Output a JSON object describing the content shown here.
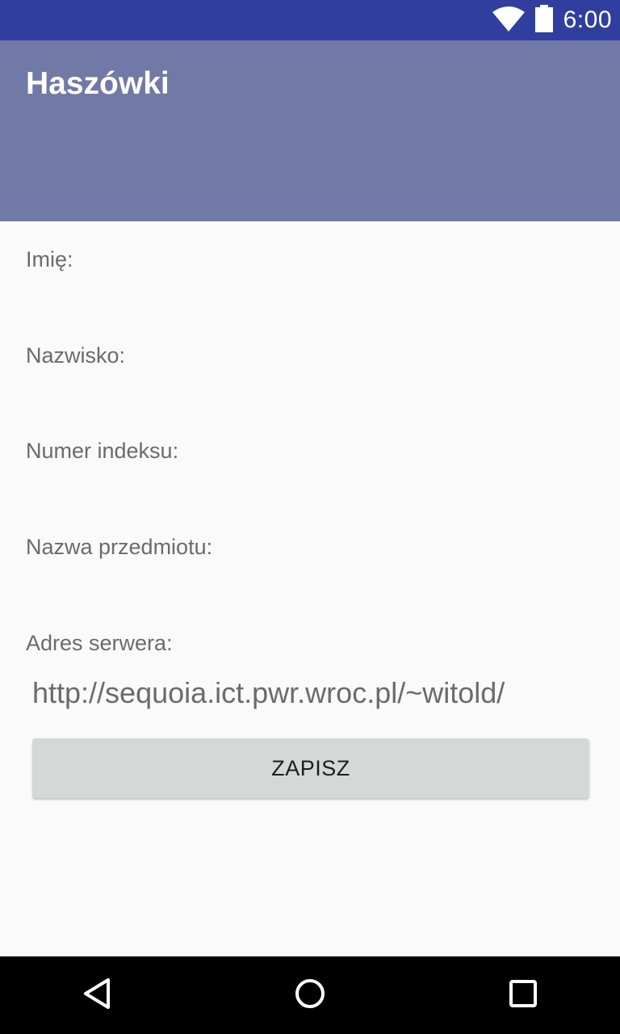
{
  "status_bar": {
    "time": "6:00",
    "icons": [
      "wifi-icon",
      "battery-icon"
    ],
    "color": "#303f9f"
  },
  "app_bar": {
    "title": "Haszówki",
    "color": "#7179a6"
  },
  "form": {
    "first_name_label": "Imię:",
    "last_name_label": "Nazwisko:",
    "index_number_label": "Numer indeksu:",
    "subject_name_label": "Nazwa przedmiotu:",
    "server_address_label": "Adres serwera:",
    "server_address_value": "http://sequoia.ict.pwr.wroc.pl/~witold/"
  },
  "actions": {
    "save_label": "ZAPISZ"
  },
  "nav_bar": {
    "icons": [
      "back-icon",
      "home-icon",
      "recents-icon"
    ]
  }
}
